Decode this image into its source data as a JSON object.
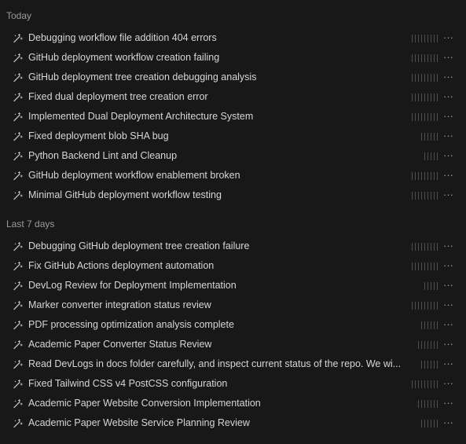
{
  "sections": [
    {
      "label": "Today",
      "items": [
        {
          "title": "Debugging workflow file addition 404 errors",
          "ticks": 9
        },
        {
          "title": "GitHub deployment workflow creation failing",
          "ticks": 9
        },
        {
          "title": "GitHub deployment tree creation debugging analysis",
          "ticks": 9
        },
        {
          "title": "Fixed dual deployment tree creation error",
          "ticks": 9
        },
        {
          "title": "Implemented Dual Deployment Architecture System",
          "ticks": 9
        },
        {
          "title": "Fixed deployment blob SHA bug",
          "ticks": 6
        },
        {
          "title": "Python Backend Lint and Cleanup",
          "ticks": 5
        },
        {
          "title": "GitHub deployment workflow enablement broken",
          "ticks": 9
        },
        {
          "title": "Minimal GitHub deployment workflow testing",
          "ticks": 9
        }
      ]
    },
    {
      "label": "Last 7 days",
      "items": [
        {
          "title": "Debugging GitHub deployment tree creation failure",
          "ticks": 9
        },
        {
          "title": "Fix GitHub Actions deployment automation",
          "ticks": 9
        },
        {
          "title": "DevLog Review for Deployment Implementation",
          "ticks": 5
        },
        {
          "title": "Marker converter integration status review",
          "ticks": 9
        },
        {
          "title": "PDF processing optimization analysis complete",
          "ticks": 6
        },
        {
          "title": "Academic Paper Converter Status Review",
          "ticks": 7
        },
        {
          "title": "Read DevLogs in docs folder carefully, and inspect current status of the repo. We wi...",
          "ticks": 6
        },
        {
          "title": "Fixed Tailwind CSS v4 PostCSS configuration",
          "ticks": 9
        },
        {
          "title": "Academic Paper Website Conversion Implementation",
          "ticks": 7
        },
        {
          "title": "Academic Paper Website Service Planning Review",
          "ticks": 6
        }
      ]
    }
  ],
  "more_glyph": "···",
  "icon": "magic-wand-icon",
  "colors": {
    "background": "#181818",
    "text": "#d6d6d6",
    "section_label": "#9a9a9a",
    "tick": "#4e4e4e"
  }
}
